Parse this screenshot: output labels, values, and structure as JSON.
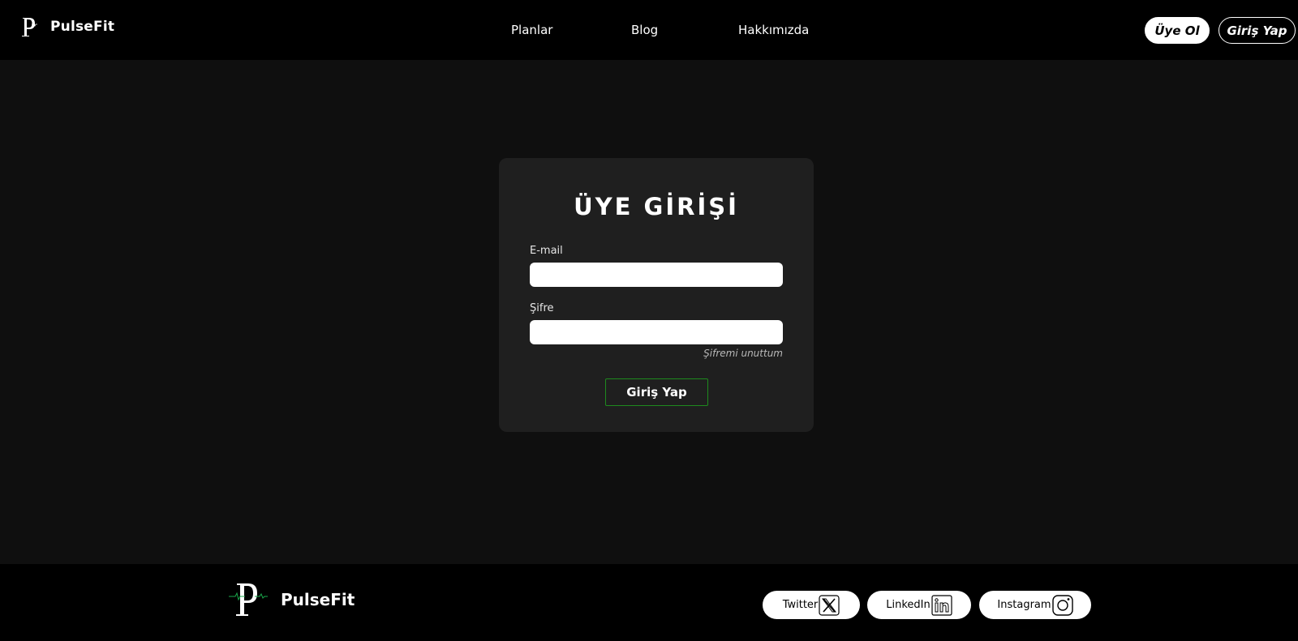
{
  "header": {
    "brand": {
      "logo_letter": "P",
      "name": "PulseFit"
    },
    "nav": [
      "Planlar",
      "Blog",
      "Hakkımızda"
    ],
    "signup_label": "Üye Ol",
    "login_label": "Giriş Yap"
  },
  "login_form": {
    "title": "ÜYE GİRİŞİ",
    "email_label": "E-mail",
    "email_value": "",
    "password_label": "Şifre",
    "password_value": "",
    "forgot_label": "Şifremi unuttum",
    "submit_label": "Giriş Yap"
  },
  "footer": {
    "brand_name": "PulseFit",
    "social": [
      {
        "label": "Twitter",
        "icon": "x-icon"
      },
      {
        "label": "LinkedIn",
        "icon": "linkedin-icon"
      },
      {
        "label": "Instagram",
        "icon": "instagram-icon"
      }
    ]
  },
  "colors": {
    "header_bg": "#000000",
    "page_bg": "#0f0f0f",
    "card_bg": "#1f1f1f",
    "submit_border": "#1e8a1e",
    "logo_pulse": "#1aa84b"
  }
}
